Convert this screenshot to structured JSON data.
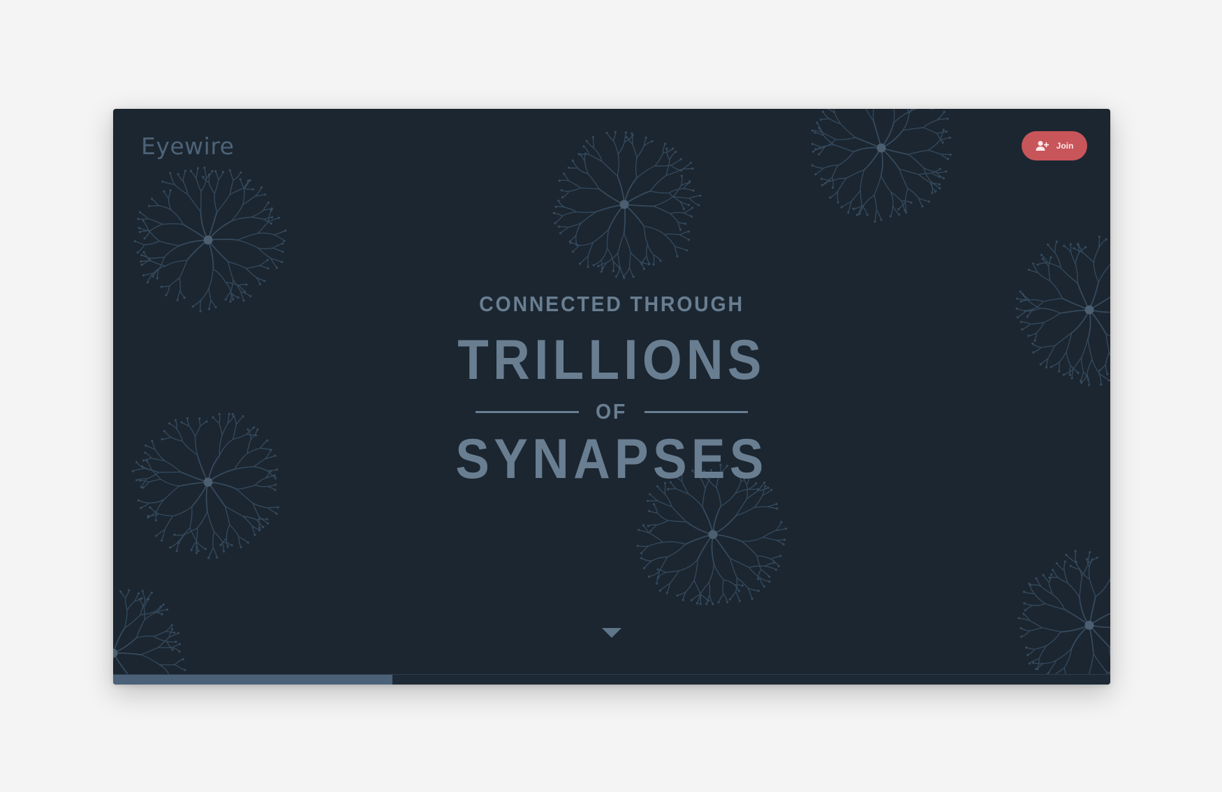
{
  "app": {
    "logo": "Eyewire"
  },
  "header": {
    "join_label": "Join",
    "join_icon": "user-plus-icon"
  },
  "hero": {
    "line1": "CONNECTED THROUGH",
    "line2": "TRILLIONS",
    "line3": "OF",
    "line4": "SYNAPSES"
  },
  "scroll": {
    "icon": "caret-down-icon"
  },
  "progress": {
    "fraction": 0.28
  },
  "colors": {
    "background": "#1b2631",
    "accent": "#c8555a",
    "text": "#697e91",
    "neuron": "#364a5c",
    "progress": "#4a6178"
  }
}
